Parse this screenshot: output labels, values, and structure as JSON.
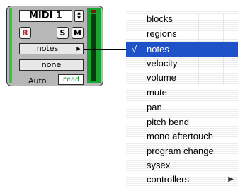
{
  "track": {
    "name": "MIDI 1",
    "record_label": "R",
    "solo_label": "S",
    "mute_label": "M",
    "view_label": "notes",
    "channel_label": "none",
    "auto_label": "Auto",
    "auto_mode": "read",
    "colors": {
      "strip_bg": "#b7b7b7",
      "track_color": "#35c43b",
      "meter_green": "#19a330",
      "record_red": "#c4272a"
    }
  },
  "menu": {
    "check_mark": "√",
    "selected_color": "#1f52c8",
    "items": [
      {
        "label": "blocks"
      },
      {
        "label": "regions"
      },
      {
        "label": "notes",
        "selected": true
      },
      {
        "label": "velocity"
      },
      {
        "label": "volume"
      },
      {
        "label": "mute"
      },
      {
        "label": "pan"
      },
      {
        "label": "pitch bend"
      },
      {
        "label": "mono aftertouch"
      },
      {
        "label": "program change"
      },
      {
        "label": "sysex"
      },
      {
        "label": "controllers",
        "submenu": true
      }
    ]
  }
}
